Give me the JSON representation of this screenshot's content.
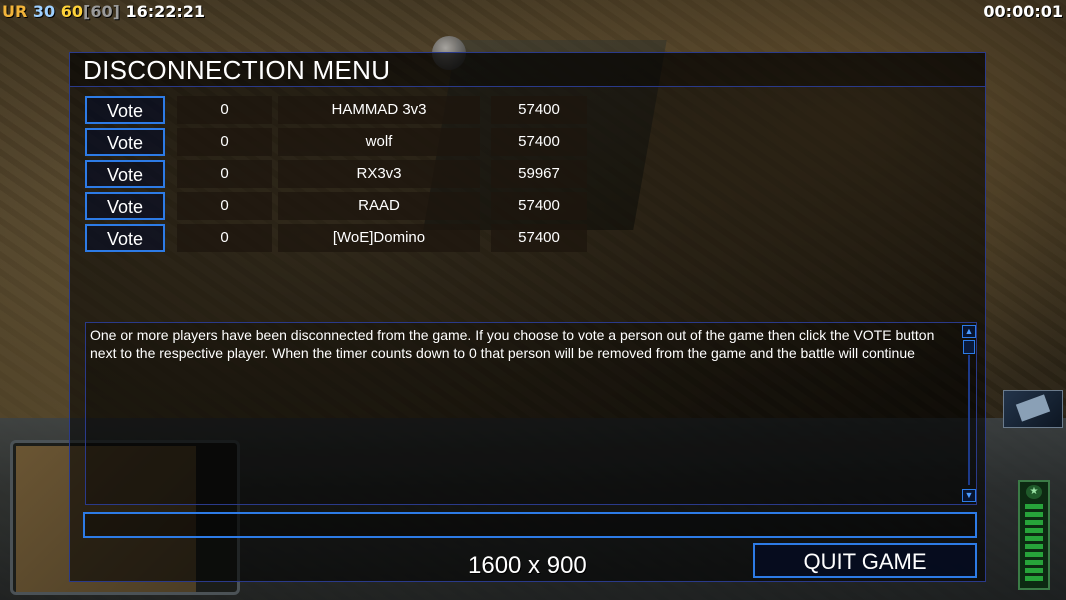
{
  "topbar": {
    "ur_label": "UR",
    "fps_current": "30",
    "fps_target": "60",
    "fps_cap": "[60]",
    "clock": "16:22:21",
    "game_timer": "00:00:01"
  },
  "dialog": {
    "title": "DISCONNECTION MENU",
    "players": [
      {
        "vote_label": "Vote",
        "votes": "0",
        "name": "HAMMAD 3v3",
        "ping": "57400"
      },
      {
        "vote_label": "Vote",
        "votes": "0",
        "name": "wolf",
        "ping": "57400"
      },
      {
        "vote_label": "Vote",
        "votes": "0",
        "name": "RX3v3",
        "ping": "59967"
      },
      {
        "vote_label": "Vote",
        "votes": "0",
        "name": "RAAD",
        "ping": "57400"
      },
      {
        "vote_label": "Vote",
        "votes": "0",
        "name": "[WoE]Domino",
        "ping": "57400"
      }
    ],
    "message": "One or more players have been disconnected from the game. If you choose to vote a person out of the game then click the VOTE button next to the respective player. When the timer counts down to 0 that person will be removed from the game and the battle will continue",
    "chat_value": "",
    "quit_label": "QUIT GAME"
  },
  "overlay": {
    "resolution": "1600 x 900"
  },
  "icons": {
    "scroll_up": "triangle-up-icon",
    "scroll_down": "triangle-down-icon",
    "star": "star-icon"
  },
  "colors": {
    "accent_blue": "#2d7be6",
    "title_white": "#ffffff",
    "ur_orange": "#f2b43a",
    "fps_yellow": "#ffd23a"
  }
}
